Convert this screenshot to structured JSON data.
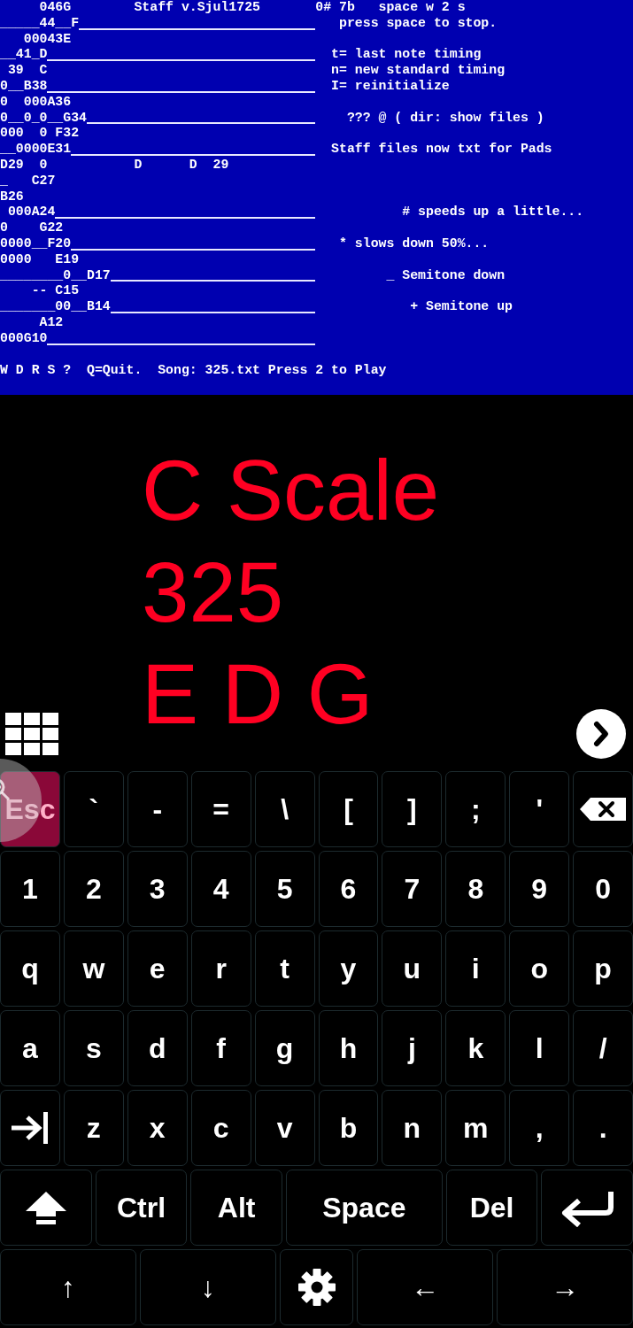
{
  "terminal": {
    "rows": [
      {
        "left": "     046G        Staff v.Sjul1725",
        "staff": false,
        "right": "0# 7b   space w 2 s"
      },
      {
        "left": "_____44__F",
        "staff": true,
        "right": "   press space to stop."
      },
      {
        "left": "   00043E",
        "staff": false
      },
      {
        "left": "__41_D",
        "staff": true,
        "right": "  t= last note timing"
      },
      {
        "left": " 39  C",
        "staff": false,
        "right": "  n= new standard timing"
      },
      {
        "left": "0__B38",
        "staff": true,
        "right": "  I= reinitialize"
      },
      {
        "left": "0  000A36",
        "staff": false
      },
      {
        "left": "0__0_0__G34",
        "staff": true,
        "right": "    ??? @ ( dir: show files )"
      },
      {
        "left": "000  0 F32",
        "staff": false
      },
      {
        "left": "__0000E31",
        "staff": true,
        "right": "  Staff files now txt for Pads"
      },
      {
        "left": "D29  0           D      D  29",
        "staff": false
      },
      {
        "left": "_   C27",
        "staff": false
      },
      {
        "left": "B26",
        "staff": false
      },
      {
        "left": " 000A24",
        "staff": true,
        "right": "           # speeds up a little..."
      },
      {
        "left": "0    G22",
        "staff": false
      },
      {
        "left": "0000__F20",
        "staff": true,
        "right": "   * slows down 50%..."
      },
      {
        "left": "0000   E19",
        "staff": false
      },
      {
        "left": "________0__D17",
        "staff": true,
        "right": "         _ Semitone down"
      },
      {
        "left": "    -- C15",
        "staff": false
      },
      {
        "left": "_______00__B14",
        "staff": true,
        "right": "            + Semitone up"
      },
      {
        "left": "     A12",
        "staff": false
      },
      {
        "left": "000G10",
        "staff": true
      }
    ],
    "status": "W D R S ?  Q=Quit.  Song: 325.txt Press 2 to Play"
  },
  "display": {
    "lines": [
      "C Scale",
      "325",
      "E D G"
    ]
  },
  "keyboard": {
    "rows": [
      {
        "keys": [
          {
            "kind": "esc",
            "label": "Esc"
          },
          {
            "kind": "text",
            "label": "`"
          },
          {
            "kind": "text",
            "label": "-"
          },
          {
            "kind": "text",
            "label": "="
          },
          {
            "kind": "text",
            "label": "\\"
          },
          {
            "kind": "text",
            "label": "["
          },
          {
            "kind": "text",
            "label": "]"
          },
          {
            "kind": "text",
            "label": ";"
          },
          {
            "kind": "text",
            "label": "'"
          },
          {
            "kind": "backspace"
          }
        ]
      },
      {
        "keys": [
          {
            "kind": "text",
            "label": "1"
          },
          {
            "kind": "text",
            "label": "2"
          },
          {
            "kind": "text",
            "label": "3"
          },
          {
            "kind": "text",
            "label": "4"
          },
          {
            "kind": "text",
            "label": "5"
          },
          {
            "kind": "text",
            "label": "6"
          },
          {
            "kind": "text",
            "label": "7"
          },
          {
            "kind": "text",
            "label": "8"
          },
          {
            "kind": "text",
            "label": "9"
          },
          {
            "kind": "text",
            "label": "0"
          }
        ]
      },
      {
        "keys": [
          {
            "kind": "text",
            "label": "q"
          },
          {
            "kind": "text",
            "label": "w"
          },
          {
            "kind": "text",
            "label": "e"
          },
          {
            "kind": "text",
            "label": "r"
          },
          {
            "kind": "text",
            "label": "t"
          },
          {
            "kind": "text",
            "label": "y"
          },
          {
            "kind": "text",
            "label": "u"
          },
          {
            "kind": "text",
            "label": "i"
          },
          {
            "kind": "text",
            "label": "o"
          },
          {
            "kind": "text",
            "label": "p"
          }
        ]
      },
      {
        "keys": [
          {
            "kind": "text",
            "label": "a"
          },
          {
            "kind": "text",
            "label": "s"
          },
          {
            "kind": "text",
            "label": "d"
          },
          {
            "kind": "text",
            "label": "f"
          },
          {
            "kind": "text",
            "label": "g"
          },
          {
            "kind": "text",
            "label": "h"
          },
          {
            "kind": "text",
            "label": "j"
          },
          {
            "kind": "text",
            "label": "k"
          },
          {
            "kind": "text",
            "label": "l"
          },
          {
            "kind": "text",
            "label": "/"
          }
        ]
      },
      {
        "keys": [
          {
            "kind": "tab"
          },
          {
            "kind": "text",
            "label": "z"
          },
          {
            "kind": "text",
            "label": "x"
          },
          {
            "kind": "text",
            "label": "c"
          },
          {
            "kind": "text",
            "label": "v"
          },
          {
            "kind": "text",
            "label": "b"
          },
          {
            "kind": "text",
            "label": "n"
          },
          {
            "kind": "text",
            "label": "m"
          },
          {
            "kind": "text",
            "label": ","
          },
          {
            "kind": "text",
            "label": "."
          }
        ]
      },
      {
        "keys": [
          {
            "kind": "shift"
          },
          {
            "kind": "text",
            "label": "Ctrl"
          },
          {
            "kind": "text",
            "label": "Alt"
          },
          {
            "kind": "text",
            "label": "Space"
          },
          {
            "kind": "text",
            "label": "Del"
          },
          {
            "kind": "enter"
          }
        ]
      },
      {
        "keys": [
          {
            "kind": "text",
            "label": "↑"
          },
          {
            "kind": "text",
            "label": "↓"
          },
          {
            "kind": "settings"
          },
          {
            "kind": "text",
            "label": "←"
          },
          {
            "kind": "text",
            "label": "→"
          }
        ]
      }
    ]
  }
}
